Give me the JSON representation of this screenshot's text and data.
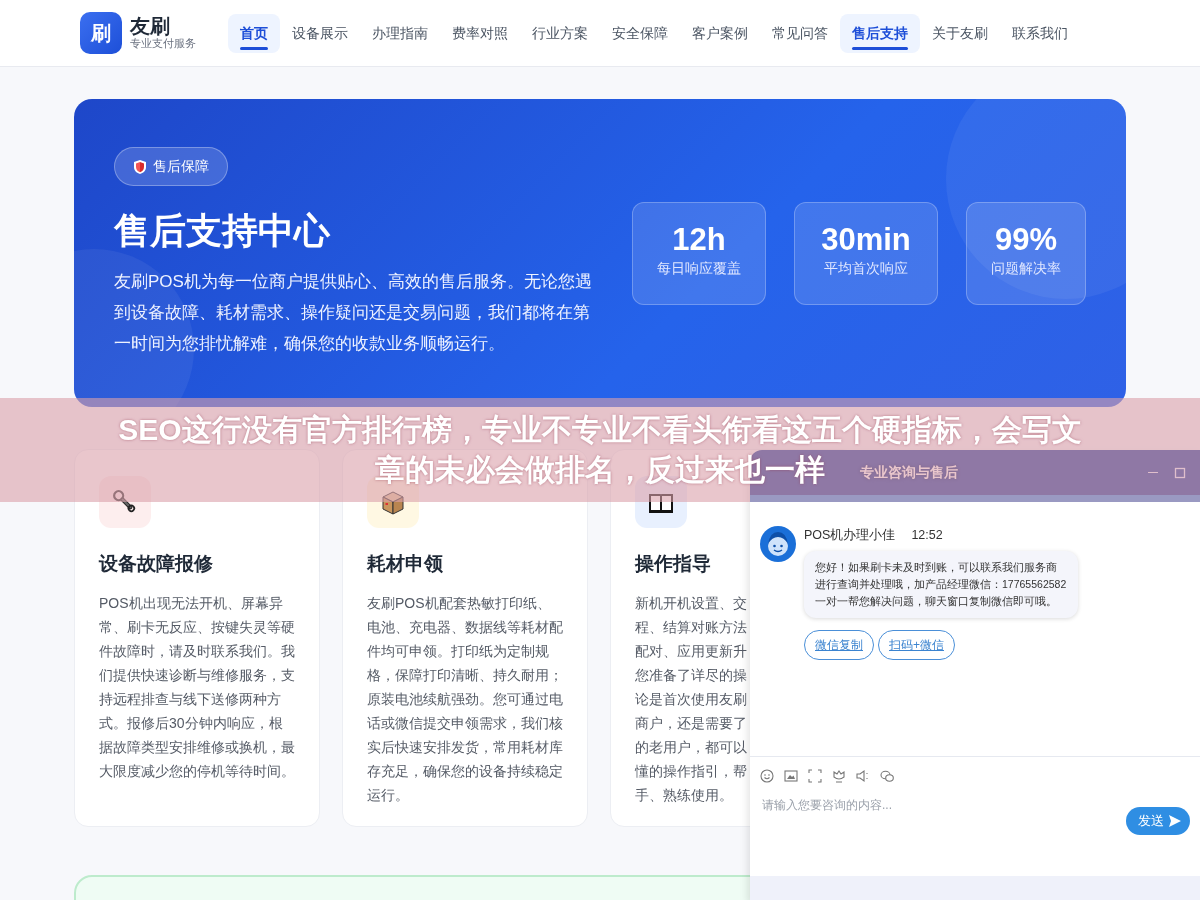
{
  "nav": {
    "logo": "刷",
    "brand": "友刷",
    "tagline": "专业支付服务",
    "items": [
      {
        "label": "首页",
        "selected": true
      },
      {
        "label": "设备展示",
        "selected": false
      },
      {
        "label": "办理指南",
        "selected": false
      },
      {
        "label": "费率对照",
        "selected": false
      },
      {
        "label": "行业方案",
        "selected": false
      },
      {
        "label": "安全保障",
        "selected": false
      },
      {
        "label": "客户案例",
        "selected": false
      },
      {
        "label": "常见问答",
        "selected": false
      },
      {
        "label": "售后支持",
        "selected": true
      },
      {
        "label": "关于友刷",
        "selected": false
      },
      {
        "label": "联系我们",
        "selected": false
      }
    ]
  },
  "hero": {
    "badge": "售后保障",
    "title": "售后支持中心",
    "description": "友刷POS机为每一位商户提供贴心、高效的售后服务。无论您遇到设备故障、耗材需求、操作疑问还是交易问题，我们都将在第一时间为您排忧解难，确保您的收款业务顺畅运行。",
    "stats": [
      {
        "value": "12h",
        "label": "每日响应覆盖"
      },
      {
        "value": "30min",
        "label": "平均首次响应"
      },
      {
        "value": "99%",
        "label": "问题解决率"
      }
    ]
  },
  "services": [
    {
      "kind": "wrench",
      "title": "设备故障报修",
      "description": "POS机出现无法开机、屏幕异常、刷卡无反应、按键失灵等硬件故障时，请及时联系我们。我们提供快速诊断与维修服务，支持远程排查与线下送修两种方式。报修后30分钟内响应，根据故障类型安排维修或换机，最大限度减少您的停机等待时间。"
    },
    {
      "kind": "box",
      "title": "耗材申领",
      "description": "友刷POS机配套热敏打印纸、电池、充电器、数据线等耗材配件均可申领。打印纸为定制规格，保障打印清晰、持久耐用；原装电池续航强劲。您可通过电话或微信提交申领需求，我们核实后快速安排发货，常用耗材库存充足，确保您的设备持续稳定运行。"
    },
    {
      "kind": "book",
      "title": "操作指导",
      "lines": [
        "新机开机设置、交",
        "程、结算对账方法",
        "配对、应用更新升",
        "您准备了详尽的操",
        "论是首次使用友刷",
        "商户，还是需要了",
        "的老用户，都可以",
        "懂的操作指引，帮",
        "手、熟练使用。"
      ]
    }
  ],
  "chat": {
    "title": "专业咨询与售后",
    "agent": "POS机办理小佳",
    "time": "12:52",
    "message": "您好！如果刷卡未及时到账，可以联系我们服务商进行查询并处理哦，加产品经理微信：17765562582 一对一帮您解决问题，聊天窗口复制微信即可哦。",
    "actions": [
      "微信复制",
      "扫码+微信"
    ],
    "placeholder": "请输入您要咨询的内容...",
    "send": "发送"
  },
  "banner": {
    "lines": [
      "SEO这行没有官方排行榜，专业不专业不看头衔看这五个硬指标，会写文",
      "章的未必会做排名，反过来也一样"
    ]
  }
}
